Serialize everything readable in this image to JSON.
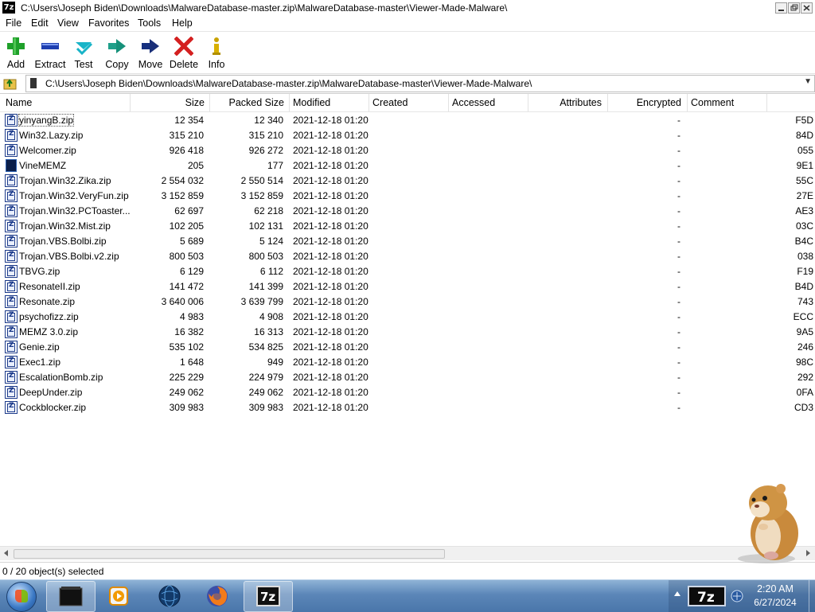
{
  "window": {
    "title": "C:\\Users\\Joseph Biden\\Downloads\\MalwareDatabase-master.zip\\MalwareDatabase-master\\Viewer-Made-Malware\\",
    "app_icon_text": "7z"
  },
  "menu": [
    "File",
    "Edit",
    "View",
    "Favorites",
    "Tools",
    "Help"
  ],
  "toolbar": [
    {
      "label": "Add",
      "icon": "plus-icon"
    },
    {
      "label": "Extract",
      "icon": "minus-icon"
    },
    {
      "label": "Test",
      "icon": "check-icon"
    },
    {
      "label": "Copy",
      "icon": "copy-arrow-icon"
    },
    {
      "label": "Move",
      "icon": "move-arrow-icon"
    },
    {
      "label": "Delete",
      "icon": "delete-x-icon"
    },
    {
      "label": "Info",
      "icon": "info-icon"
    }
  ],
  "address": {
    "path": "C:\\Users\\Joseph Biden\\Downloads\\MalwareDatabase-master.zip\\MalwareDatabase-master\\Viewer-Made-Malware\\"
  },
  "columns": [
    "Name",
    "Size",
    "Packed Size",
    "Modified",
    "Created",
    "Accessed",
    "Attributes",
    "Encrypted",
    "Comment"
  ],
  "files": [
    {
      "name": "yinyangB.zip",
      "size": "12 354",
      "packed": "12 340",
      "modified": "2021-12-18 01:20",
      "encrypted": "-",
      "crc": "F5D",
      "icon": "zip-file-icon"
    },
    {
      "name": "Win32.Lazy.zip",
      "size": "315 210",
      "packed": "315 210",
      "modified": "2021-12-18 01:20",
      "encrypted": "-",
      "crc": "84D",
      "icon": "zip-file-icon"
    },
    {
      "name": "Welcomer.zip",
      "size": "926 418",
      "packed": "926 272",
      "modified": "2021-12-18 01:20",
      "encrypted": "-",
      "crc": "055",
      "icon": "zip-file-icon"
    },
    {
      "name": "VineMEMZ",
      "size": "205",
      "packed": "177",
      "modified": "2021-12-18 01:20",
      "encrypted": "-",
      "crc": "9E1",
      "icon": "executable-file-icon"
    },
    {
      "name": "Trojan.Win32.Zika.zip",
      "size": "2 554 032",
      "packed": "2 550 514",
      "modified": "2021-12-18 01:20",
      "encrypted": "-",
      "crc": "55C",
      "icon": "zip-file-icon"
    },
    {
      "name": "Trojan.Win32.VeryFun.zip",
      "size": "3 152 859",
      "packed": "3 152 859",
      "modified": "2021-12-18 01:20",
      "encrypted": "-",
      "crc": "27E",
      "icon": "zip-file-icon"
    },
    {
      "name": "Trojan.Win32.PCToaster...",
      "size": "62 697",
      "packed": "62 218",
      "modified": "2021-12-18 01:20",
      "encrypted": "-",
      "crc": "AE3",
      "icon": "zip-file-icon"
    },
    {
      "name": "Trojan.Win32.Mist.zip",
      "size": "102 205",
      "packed": "102 131",
      "modified": "2021-12-18 01:20",
      "encrypted": "-",
      "crc": "03C",
      "icon": "zip-file-icon"
    },
    {
      "name": "Trojan.VBS.Bolbi.zip",
      "size": "5 689",
      "packed": "5 124",
      "modified": "2021-12-18 01:20",
      "encrypted": "-",
      "crc": "B4C",
      "icon": "zip-file-icon"
    },
    {
      "name": "Trojan.VBS.Bolbi.v2.zip",
      "size": "800 503",
      "packed": "800 503",
      "modified": "2021-12-18 01:20",
      "encrypted": "-",
      "crc": "038",
      "icon": "zip-file-icon"
    },
    {
      "name": "TBVG.zip",
      "size": "6 129",
      "packed": "6 112",
      "modified": "2021-12-18 01:20",
      "encrypted": "-",
      "crc": "F19",
      "icon": "zip-file-icon"
    },
    {
      "name": "ResonateII.zip",
      "size": "141 472",
      "packed": "141 399",
      "modified": "2021-12-18 01:20",
      "encrypted": "-",
      "crc": "B4D",
      "icon": "zip-file-icon"
    },
    {
      "name": "Resonate.zip",
      "size": "3 640 006",
      "packed": "3 639 799",
      "modified": "2021-12-18 01:20",
      "encrypted": "-",
      "crc": "743",
      "icon": "zip-file-icon"
    },
    {
      "name": "psychofizz.zip",
      "size": "4 983",
      "packed": "4 908",
      "modified": "2021-12-18 01:20",
      "encrypted": "-",
      "crc": "ECC",
      "icon": "zip-file-icon"
    },
    {
      "name": "MEMZ 3.0.zip",
      "size": "16 382",
      "packed": "16 313",
      "modified": "2021-12-18 01:20",
      "encrypted": "-",
      "crc": "9A5",
      "icon": "zip-file-icon"
    },
    {
      "name": "Genie.zip",
      "size": "535 102",
      "packed": "534 825",
      "modified": "2021-12-18 01:20",
      "encrypted": "-",
      "crc": "246",
      "icon": "zip-file-icon"
    },
    {
      "name": "Exec1.zip",
      "size": "1 648",
      "packed": "949",
      "modified": "2021-12-18 01:20",
      "encrypted": "-",
      "crc": "98C",
      "icon": "zip-file-icon"
    },
    {
      "name": "EscalationBomb.zip",
      "size": "225 229",
      "packed": "224 979",
      "modified": "2021-12-18 01:20",
      "encrypted": "-",
      "crc": "292",
      "icon": "zip-file-icon"
    },
    {
      "name": "DeepUnder.zip",
      "size": "249 062",
      "packed": "249 062",
      "modified": "2021-12-18 01:20",
      "encrypted": "-",
      "crc": "0FA",
      "icon": "zip-file-icon"
    },
    {
      "name": "Cockblocker.zip",
      "size": "309 983",
      "packed": "309 983",
      "modified": "2021-12-18 01:20",
      "encrypted": "-",
      "crc": "CD3",
      "icon": "zip-file-icon"
    }
  ],
  "status": {
    "selection": "0 / 20 object(s) selected"
  },
  "taskbar": {
    "items": [
      {
        "icon": "start-orb-icon"
      },
      {
        "icon": "terminal-window-icon",
        "active": true
      },
      {
        "icon": "media-player-icon"
      },
      {
        "icon": "globe-icon"
      },
      {
        "icon": "firefox-icon"
      },
      {
        "icon": "7zip-icon",
        "active": true
      }
    ],
    "clock": {
      "time": "2:20 AM",
      "date": "6/27/2024"
    }
  },
  "colors": {
    "taskbar": "#5b86b8",
    "delete_red": "#d42020",
    "add_green": "#1fa02a",
    "extract_blue": "#1e3fb0",
    "test_cyan": "#19b4c8"
  }
}
